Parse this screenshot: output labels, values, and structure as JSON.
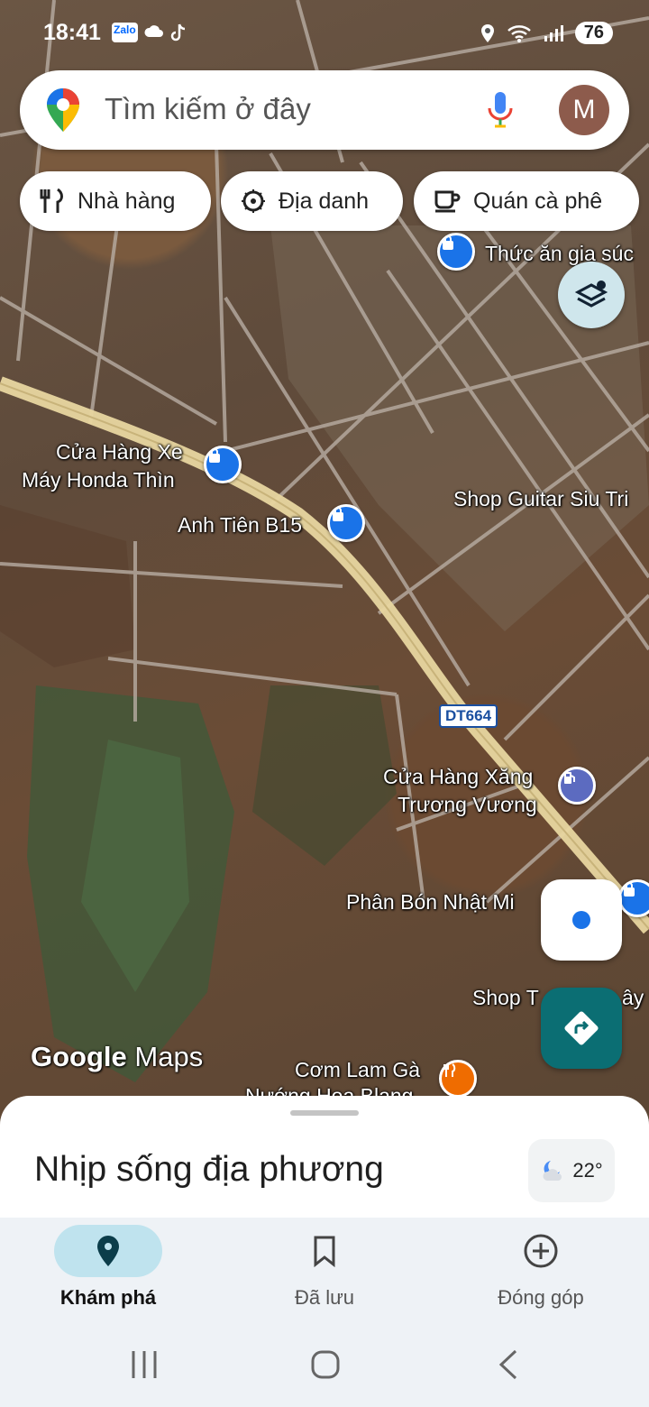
{
  "status_bar": {
    "time": "18:41",
    "app_icons": [
      "Zalo",
      "cloud-icon",
      "tiktok-icon"
    ],
    "battery": "76"
  },
  "search": {
    "placeholder": "Tìm kiếm ở đây",
    "avatar_initial": "M"
  },
  "chips": [
    {
      "label": "Nhà hàng",
      "icon": "restaurant-icon"
    },
    {
      "label": "Địa danh",
      "icon": "landmark-icon"
    },
    {
      "label": "Quán cà phê",
      "icon": "coffee-icon"
    }
  ],
  "map": {
    "road_shield": "DT664",
    "places": [
      {
        "name": "Thức ăn gia súc",
        "type": "shop"
      },
      {
        "name": "Cửa Hàng Xe",
        "type": "shop"
      },
      {
        "name": "Máy Honda Thìn",
        "type": "shop"
      },
      {
        "name": "Anh Tiên B15",
        "type": "shop"
      },
      {
        "name": "Shop Guitar Siu Tri",
        "type": "label"
      },
      {
        "name": "Cửa Hàng Xăng",
        "type": "fuel"
      },
      {
        "name": "Trương Vương",
        "type": "fuel"
      },
      {
        "name": "Phân Bón Nhật Mi",
        "type": "shop"
      },
      {
        "name": "Shop T",
        "type": "label"
      },
      {
        "name": "ây N",
        "type": "label"
      },
      {
        "name": "Cơm Lam Gà",
        "type": "food"
      },
      {
        "name": "Nướng Hoa Blang",
        "type": "food"
      }
    ],
    "logo_google": "Google",
    "logo_maps": "Maps"
  },
  "sheet": {
    "title": "Nhịp sống địa phương",
    "temperature": "22°"
  },
  "bottom_nav": [
    {
      "label": "Khám phá",
      "icon": "explore-pin-icon",
      "active": true
    },
    {
      "label": "Đã lưu",
      "icon": "bookmark-icon",
      "active": false
    },
    {
      "label": "Đóng góp",
      "icon": "add-circle-icon",
      "active": false
    }
  ],
  "colors": {
    "accent_active_nav": "#bfe3ee",
    "directions_button": "#0b6e73",
    "shop_pin": "#1a73e8",
    "food_pin": "#ef6c00"
  }
}
